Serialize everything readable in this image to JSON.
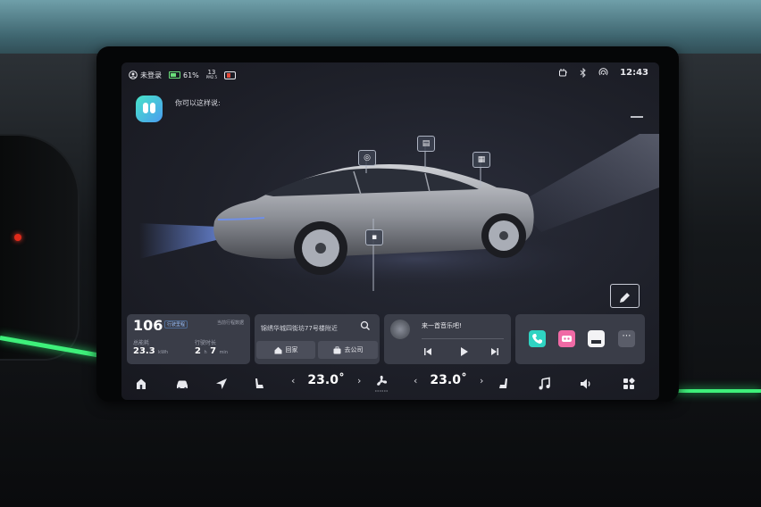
{
  "status_bar": {
    "login_status": "未登录",
    "battery_percent": "61%",
    "pm25_value": "13",
    "pm25_unit": "PM2.5",
    "time": "12:43"
  },
  "assistant": {
    "prompt": "你可以这样说:"
  },
  "car_controls": {
    "labels": [
      {
        "name": "car-mirror-control-icon",
        "glyph": "◎"
      },
      {
        "name": "car-window-control-icon",
        "glyph": "▤"
      },
      {
        "name": "car-sunshade-control-icon",
        "glyph": "▦"
      },
      {
        "name": "car-charge-port-icon",
        "glyph": "▪"
      }
    ]
  },
  "trip_widget": {
    "mileage": "106",
    "mileage_tag": "行驶里程",
    "subtitle": "当前行程数据",
    "energy_label": "总能耗",
    "energy_value": "23.3",
    "energy_unit": "kWh",
    "duration_label": "行驶时长",
    "duration_hours": "2",
    "duration_hour_unit": "h",
    "duration_minutes": "7",
    "duration_minute_unit": "min"
  },
  "nav_widget": {
    "address": "锦绣华城四街坊77号楼附近",
    "home_label": "回家",
    "work_label": "去公司"
  },
  "music_widget": {
    "title": "来一首音乐吧!"
  },
  "climate": {
    "left_temp": "23.0˚",
    "right_temp": "23.0˚",
    "decrease": "‹",
    "increase": "›"
  },
  "colors": {
    "accent_green": "#3ef07a",
    "screen_bg": "#1e2029",
    "widget_bg": "#3a3d48"
  }
}
